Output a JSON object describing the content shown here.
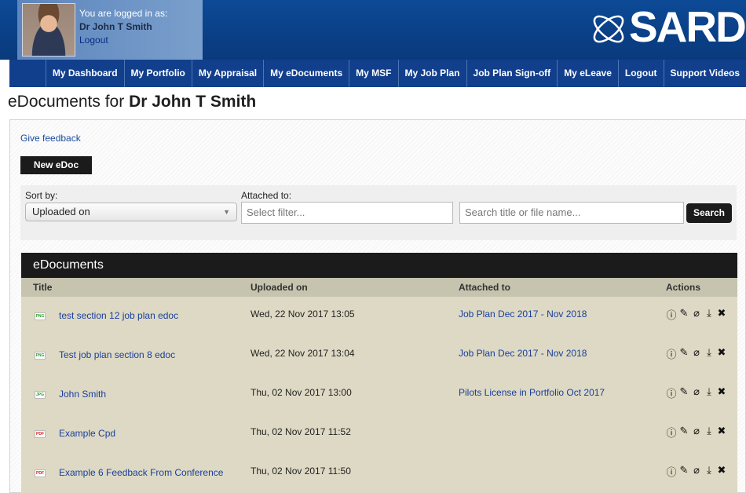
{
  "header": {
    "logged_in_label": "You are logged in as:",
    "user_name": "Dr John T Smith",
    "logout_link": "Logout",
    "logo_text": "SARD"
  },
  "nav": {
    "items": [
      {
        "label": "My Dashboard"
      },
      {
        "label": "My Portfolio"
      },
      {
        "label": "My Appraisal"
      },
      {
        "label": "My eDocuments"
      },
      {
        "label": "My MSF"
      },
      {
        "label": "My Job Plan"
      },
      {
        "label": "Job Plan Sign-off"
      },
      {
        "label": "My eLeave"
      },
      {
        "label": "Logout"
      },
      {
        "label": "Support Videos"
      }
    ]
  },
  "page": {
    "title_prefix": "eDocuments for ",
    "title_name": "Dr John T Smith",
    "feedback_link": "Give feedback",
    "new_button": "New eDoc"
  },
  "filters": {
    "sort_label": "Sort by:",
    "sort_value": "Uploaded on",
    "attached_label": "Attached to:",
    "attached_placeholder": "Select filter...",
    "search_placeholder": "Search title or file name...",
    "search_button": "Search"
  },
  "table": {
    "heading": "eDocuments",
    "columns": {
      "title": "Title",
      "uploaded": "Uploaded on",
      "attached": "Attached to",
      "actions": "Actions"
    },
    "rows": [
      {
        "icon": "PNG",
        "icon_color": "green",
        "title": "test section 12 job plan edoc",
        "uploaded": "Wed, 22 Nov 2017 13:05",
        "attached": "Job Plan Dec 2017 - Nov 2018"
      },
      {
        "icon": "PNG",
        "icon_color": "green",
        "title": "Test job plan section 8 edoc",
        "uploaded": "Wed, 22 Nov 2017 13:04",
        "attached": "Job Plan Dec 2017 - Nov 2018"
      },
      {
        "icon": "JPG",
        "icon_color": "green",
        "title": "John Smith",
        "uploaded": "Thu, 02 Nov 2017 13:00",
        "attached": "Pilots License in Portfolio Oct 2017"
      },
      {
        "icon": "PDF",
        "icon_color": "red",
        "title": "Example Cpd",
        "uploaded": "Thu, 02 Nov 2017 11:52",
        "attached": ""
      },
      {
        "icon": "PDF",
        "icon_color": "red",
        "title": "Example 6 Feedback From Conference",
        "uploaded": "Thu, 02 Nov 2017 11:50",
        "attached": ""
      }
    ],
    "action_icons": [
      "info-icon",
      "pencil-icon",
      "paperclip-icon",
      "download-icon",
      "close-icon"
    ]
  }
}
